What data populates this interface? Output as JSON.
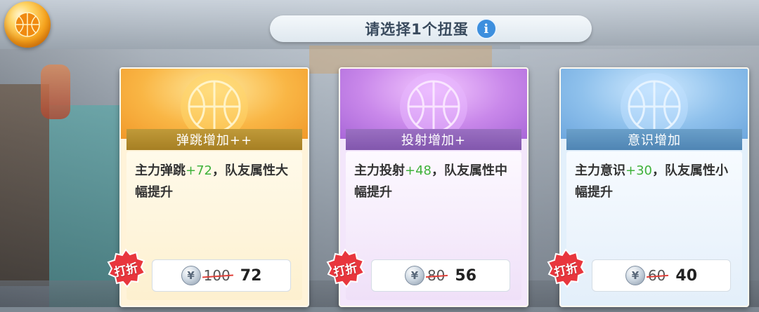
{
  "header": {
    "title": "请选择1个扭蛋",
    "info_icon": "info-icon"
  },
  "colors": {
    "accent_green": "#3fb13a",
    "strike_red": "#e0413a",
    "badge_red": "#e8363d"
  },
  "cards": [
    {
      "label": "弹跳增加++",
      "desc_prefix": "主力弹跳",
      "desc_value": "+72",
      "desc_suffix": "，队友属性大幅提升",
      "badge": "打折",
      "coin_icon": "¥",
      "old_price": "100",
      "new_price": "72",
      "theme": "gold"
    },
    {
      "label": "投射增加+",
      "desc_prefix": "主力投射",
      "desc_value": "+48",
      "desc_suffix": "，队友属性中幅提升",
      "badge": "打折",
      "coin_icon": "¥",
      "old_price": "80",
      "new_price": "56",
      "theme": "purple"
    },
    {
      "label": "意识增加",
      "desc_prefix": "主力意识",
      "desc_value": "+30",
      "desc_suffix": "，队友属性小幅提升",
      "badge": "打折",
      "coin_icon": "¥",
      "old_price": "60",
      "new_price": "40",
      "theme": "blue"
    }
  ]
}
